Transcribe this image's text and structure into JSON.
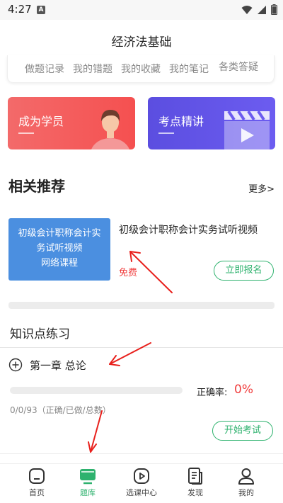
{
  "status_bar": {
    "time": "4:27",
    "a_badge": "A"
  },
  "header": {
    "title": "经济法基础"
  },
  "quick_links": [
    "做题记录",
    "我的错题",
    "我的收藏",
    "我的笔记",
    "各类答疑"
  ],
  "promo": {
    "member_label": "成为学员",
    "lecture_label": "考点精讲"
  },
  "recommend": {
    "title": "相关推荐",
    "more": "更多>",
    "course": {
      "thumb_lines": [
        "初级会计职称会计实",
        "务试听视频",
        "网络课程"
      ],
      "title": "初级会计职称会计实务试听视频",
      "price": "免费",
      "enroll": "立即报名"
    }
  },
  "practice": {
    "title": "知识点练习",
    "chapter": "第一章 总论",
    "progress": 0,
    "accuracy_label": "正确率:",
    "accuracy_value": "0%",
    "stats": "0/0/93（正确/已做/总数）",
    "exam_button": "开始考试"
  },
  "tabs": [
    {
      "label": "首页",
      "icon": "home-icon"
    },
    {
      "label": "题库",
      "icon": "question-bank-icon",
      "active": true
    },
    {
      "label": "选课中心",
      "icon": "course-center-icon"
    },
    {
      "label": "发现",
      "icon": "discover-icon"
    },
    {
      "label": "我的",
      "icon": "profile-icon"
    }
  ],
  "colors": {
    "accent_green": "#2eb26e",
    "red": "#f03c3c",
    "promo_red": "#f55050",
    "promo_purple": "#6c5cf0",
    "course_blue": "#4b8fe0"
  }
}
